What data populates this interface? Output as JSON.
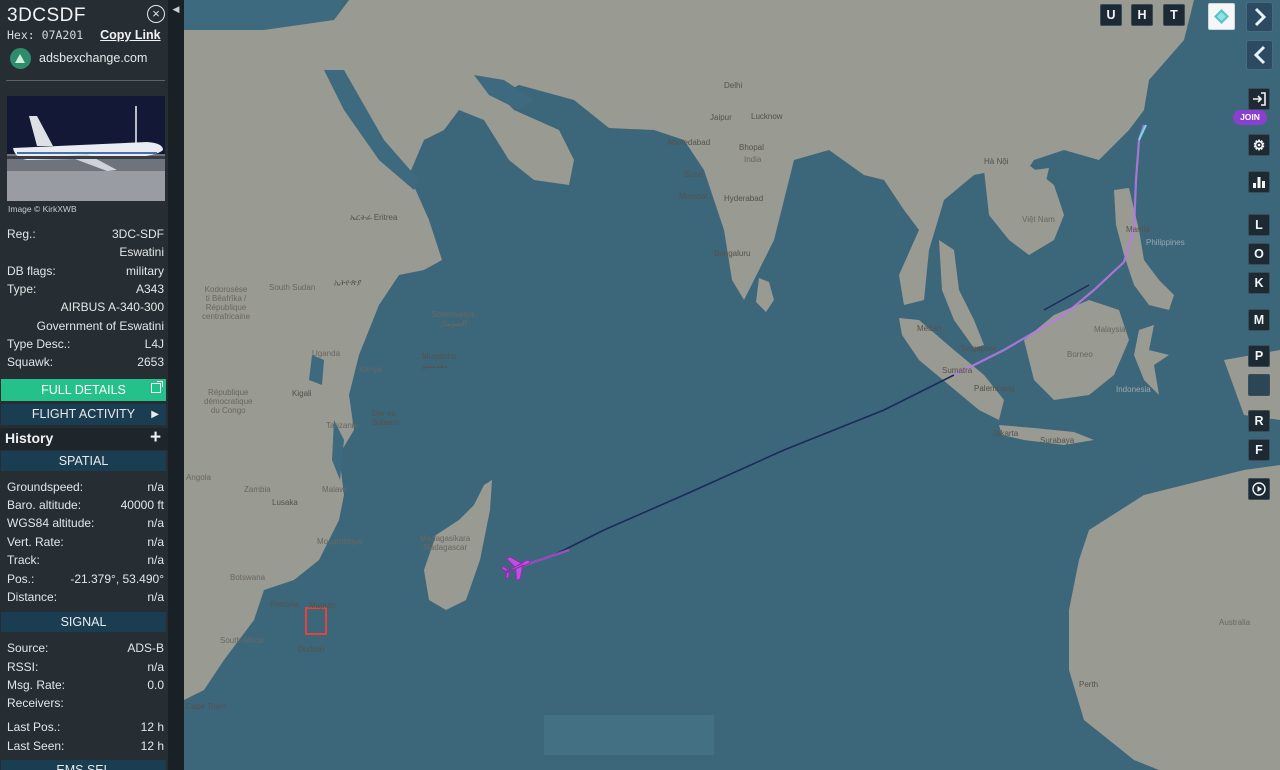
{
  "aircraft": {
    "callsign": "3DCSDF",
    "hex_label": "Hex:",
    "hex": "07A201",
    "copy_link": "Copy Link",
    "site": "adsbexchange.com",
    "photo_credit": "Image © KirkXWB"
  },
  "details": [
    {
      "key": "Reg.:",
      "value": "3DC-SDF"
    },
    {
      "key": "",
      "value": "Eswatini"
    },
    {
      "key": "DB flags:",
      "value": "military"
    },
    {
      "key": "Type:",
      "value": "A343"
    },
    {
      "key": "",
      "value": "AIRBUS A-340-300"
    },
    {
      "key": "",
      "value": "Government of Eswatini"
    },
    {
      "key": "Type Desc.:",
      "value": "L4J"
    },
    {
      "key": "Squawk:",
      "value": "2653"
    }
  ],
  "buttons": {
    "full_details": "FULL DETAILS",
    "flight_activity": "FLIGHT ACTIVITY",
    "history": "History"
  },
  "spatial": {
    "header": "SPATIAL",
    "rows": [
      {
        "key": "Groundspeed:",
        "value": "n/a"
      },
      {
        "key": "Baro. altitude:",
        "value": "40000 ft"
      },
      {
        "key": "WGS84 altitude:",
        "value": "n/a"
      },
      {
        "key": "Vert. Rate:",
        "value": "n/a"
      },
      {
        "key": "Track:",
        "value": "n/a"
      },
      {
        "key": "Pos.:",
        "value": "-21.379°, 53.490°"
      },
      {
        "key": "Distance:",
        "value": "n/a"
      }
    ]
  },
  "signal": {
    "header": "SIGNAL",
    "rows": [
      {
        "key": "Source:",
        "value": "ADS-B"
      },
      {
        "key": "RSSI:",
        "value": "n/a"
      },
      {
        "key": "Msg. Rate:",
        "value": "0.0"
      },
      {
        "key": "Receivers:",
        "value": ""
      },
      {
        "key": "Last Pos.:",
        "value": "12 h"
      },
      {
        "key": "Last Seen:",
        "value": "12 h"
      }
    ],
    "next_header": "EMS SEL"
  },
  "map_controls": {
    "top": [
      "U",
      "H",
      "T"
    ],
    "join": "JOIN",
    "letters": [
      "L",
      "O",
      "K",
      "M",
      "P",
      "R",
      "F"
    ]
  },
  "map_labels": {
    "countries": {
      "sudan": "South Sudan",
      "drc": "République\ndémocratique\ndu Congo",
      "car": "Kodorosèse\nti Bêafrîka /\nRépublique\ncentrafricaine",
      "kenya": "Kenya",
      "uganda": "Uganda",
      "tanzania": "Tanzania",
      "somalia": "Soomaaliya\nالصومال",
      "zambia": "Zambia",
      "malawi": "Malawi",
      "mozambique": "Moçambique",
      "botswana": "Botswana",
      "angola": "Angola",
      "south_africa": "South Africa",
      "madagascar": "Madagasikara\nMadagascar",
      "india": "India",
      "philippines": "Philippines",
      "indonesia": "Indonesia",
      "australia": "Australia",
      "borneo": "Borneo",
      "malaysia": "Malaysia",
      "viet_nam": "Việt Nam"
    },
    "cities": {
      "mumbai": "Mumbai",
      "hyderabad": "Hyderabad",
      "bengaluru": "Bengaluru",
      "ahmedabad": "Ahmedabad",
      "bhopal": "Bhopal",
      "jaipur": "Jaipur",
      "lucknow": "Lucknow",
      "delhi": "Delhi",
      "surat": "Surat",
      "mogadishu": "Muqdisho\nمقديشو",
      "dar": "Dar es\nSalaam",
      "kigali": "Kigali",
      "lusaka": "Lusaka",
      "pretoria": "Pretoria",
      "maputo": "Maputo",
      "durban": "Durban",
      "cape_town": "Cape Town",
      "medan": "Medan",
      "singapore": "Singapore",
      "palembang": "Palembang",
      "jakarta": "Jakarta",
      "surabaya": "Surabaya",
      "manila": "Manila",
      "ha_noi": "Hà Nội",
      "perth": "Perth",
      "eritrea": "ኤርትራ Eritrea",
      "ethiopia": "ኢትዮጵያ",
      "sumatra": "Sumatra"
    }
  }
}
